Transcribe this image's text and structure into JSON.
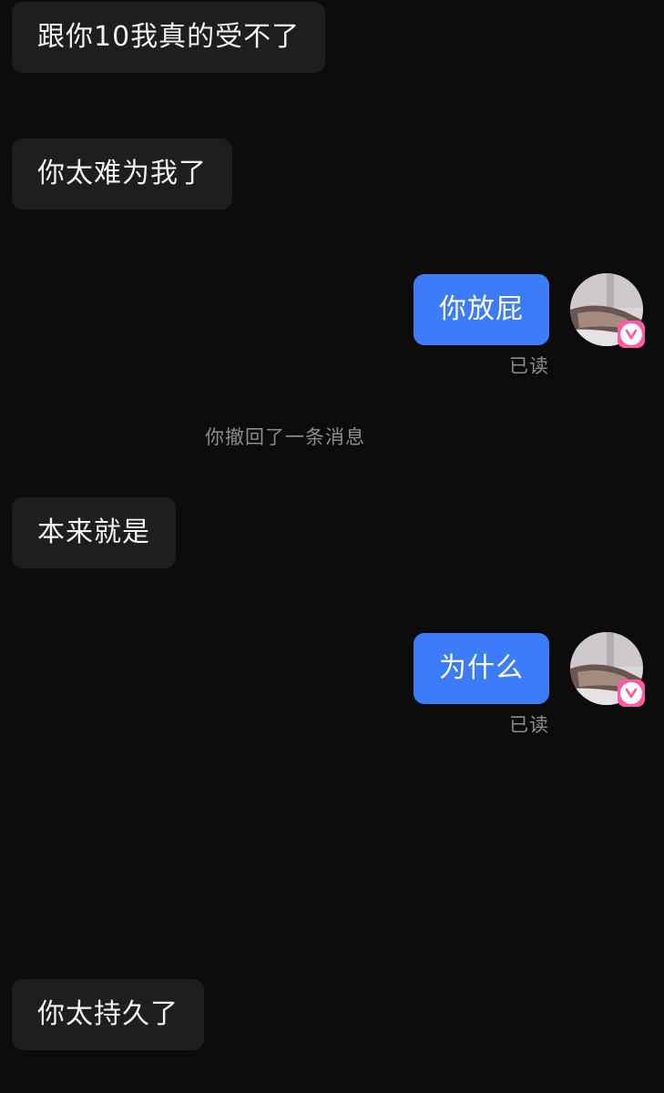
{
  "messages": {
    "m1": "跟你10我真的受不了",
    "m2": "你太难为我了",
    "m3": "你放屁",
    "m3_status": "已读",
    "recall_notice": "你撤回了一条消息",
    "m4": "本来就是",
    "m5": "为什么",
    "m5_status": "已读",
    "m6": "你太持久了"
  },
  "icons": {
    "avatar": "user-avatar-photo",
    "badge": "vip-v-badge-icon"
  },
  "colors": {
    "background": "#0c0c0d",
    "incoming_bubble": "#1e1e1f",
    "outgoing_bubble": "#3d7cf9",
    "badge": "#ff5aa5"
  }
}
